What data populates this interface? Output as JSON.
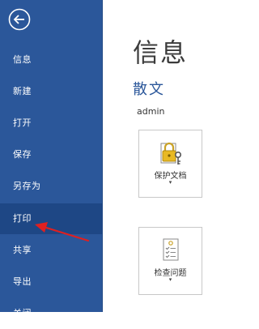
{
  "sidebar": {
    "items": [
      {
        "label": "信息"
      },
      {
        "label": "新建"
      },
      {
        "label": "打开"
      },
      {
        "label": "保存"
      },
      {
        "label": "另存为"
      },
      {
        "label": "打印"
      },
      {
        "label": "共享"
      },
      {
        "label": "导出"
      },
      {
        "label": "关闭"
      }
    ],
    "active_item": "打印",
    "background_color": "#2b579a",
    "active_color": "#1e4785"
  },
  "main": {
    "title": "信息",
    "document_name": "散文",
    "document_path": "admin",
    "actions": [
      {
        "label": "保护文档",
        "icon": "lock-key-icon",
        "caret": "▾"
      },
      {
        "label": "检查问题",
        "icon": "checklist-icon",
        "caret": "▾"
      }
    ]
  },
  "annotation": {
    "color": "#e02020",
    "points_to": "打印"
  }
}
